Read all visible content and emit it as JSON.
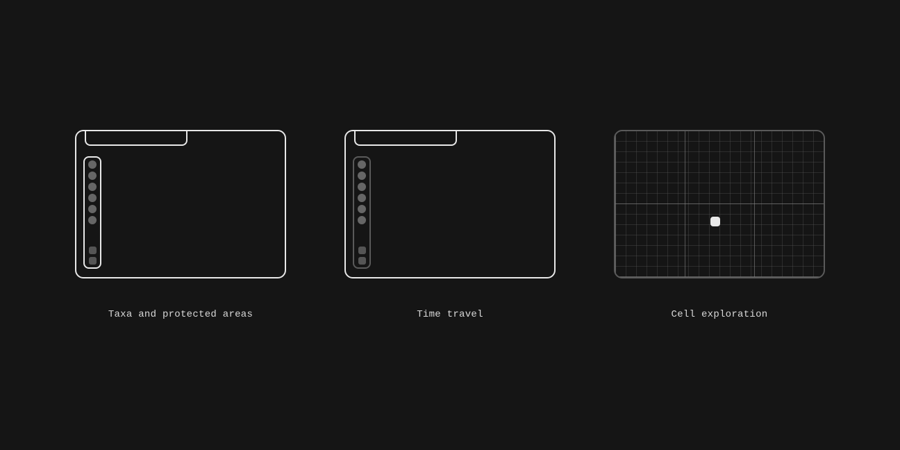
{
  "cards": [
    {
      "id": "taxa",
      "label": "Taxa and protected areas",
      "variant": "bright",
      "hasTopBar": true,
      "hasSidePanel": true,
      "hasGrid": false
    },
    {
      "id": "time-travel",
      "label": "Time travel",
      "variant": "mixed",
      "hasTopBar": true,
      "hasSidePanel": true,
      "hasGrid": false
    },
    {
      "id": "cell-exploration",
      "label": "Cell exploration",
      "variant": "grid",
      "hasTopBar": false,
      "hasSidePanel": false,
      "hasGrid": true
    }
  ]
}
